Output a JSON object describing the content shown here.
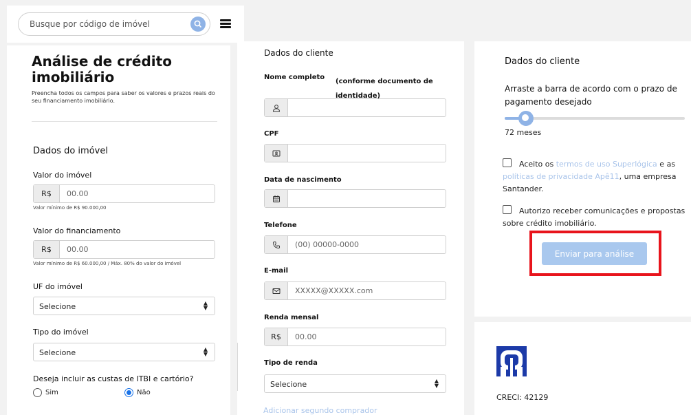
{
  "search": {
    "placeholder": "Busque por código de imóvel"
  },
  "left": {
    "title": "Análise de crédito imobiliário",
    "subtitle": "Preencha todos os campos para saber os valores e prazos reais do seu financiamento imobiliário.",
    "section_title": "Dados do imóvel",
    "property_value": {
      "label": "Valor do imóvel",
      "prefix": "R$",
      "placeholder": "00.00",
      "note": "Valor mínimo de R$ 90.000,00"
    },
    "financing_value": {
      "label": "Valor do financiamento",
      "prefix": "R$",
      "placeholder": "00.00",
      "note": "Valor mínimo de R$ 60.000,00 / Máx. 80% do valor do imóvel"
    },
    "uf": {
      "label": "UF do imóvel",
      "value": "Selecione"
    },
    "property_type": {
      "label": "Tipo do imóvel",
      "value": "Selecione"
    },
    "itbi": {
      "question": "Deseja incluir as custas de ITBI e cartório?",
      "option_yes": "Sim",
      "option_no": "Não",
      "selected": "Não"
    }
  },
  "middle": {
    "section_title": "Dados do cliente",
    "full_name": {
      "label": "Nome completo",
      "hint": "(conforme documento de identidade)",
      "value": ""
    },
    "cpf": {
      "label": "CPF",
      "value": ""
    },
    "birth_date": {
      "label": "Data de nascimento",
      "value": ""
    },
    "phone": {
      "label": "Telefone",
      "placeholder": "(00) 00000-0000"
    },
    "email": {
      "label": "E-mail",
      "placeholder": "XXXXX@XXXXX.com"
    },
    "income": {
      "label": "Renda mensal",
      "prefix": "R$",
      "placeholder": "00.00"
    },
    "income_type": {
      "label": "Tipo de renda",
      "value": "Selecione"
    },
    "add_buyer": "Adicionar segundo comprador"
  },
  "right": {
    "section_title": "Dados do cliente",
    "slider_prompt": "Arraste a barra de acordo com o prazo de pagamento desejado",
    "slider_fraction": 0.12,
    "months": "72 meses",
    "terms": {
      "text_1": "Aceito os ",
      "link_1": "termos de uso Superlógica",
      "text_2": " e as ",
      "link_2": "políticas de privacidade Apê11",
      "text_3": ", uma empresa Santander."
    },
    "consent": "Autorizo receber comunicações e propostas sobre crédito imobiliário.",
    "submit": "Enviar para análise",
    "creci": "CRECI: 42129"
  },
  "colors": {
    "accent": "#8fb3e6",
    "button": "#a9c8ee",
    "link": "#a9c4ea",
    "highlight": "#e8141c",
    "logo": "#1c3aa8"
  },
  "icons": [
    "search-icon",
    "menu-icon",
    "user-icon",
    "id-card-icon",
    "calendar-icon",
    "phone-icon",
    "envelope-icon",
    "logo-icon"
  ]
}
